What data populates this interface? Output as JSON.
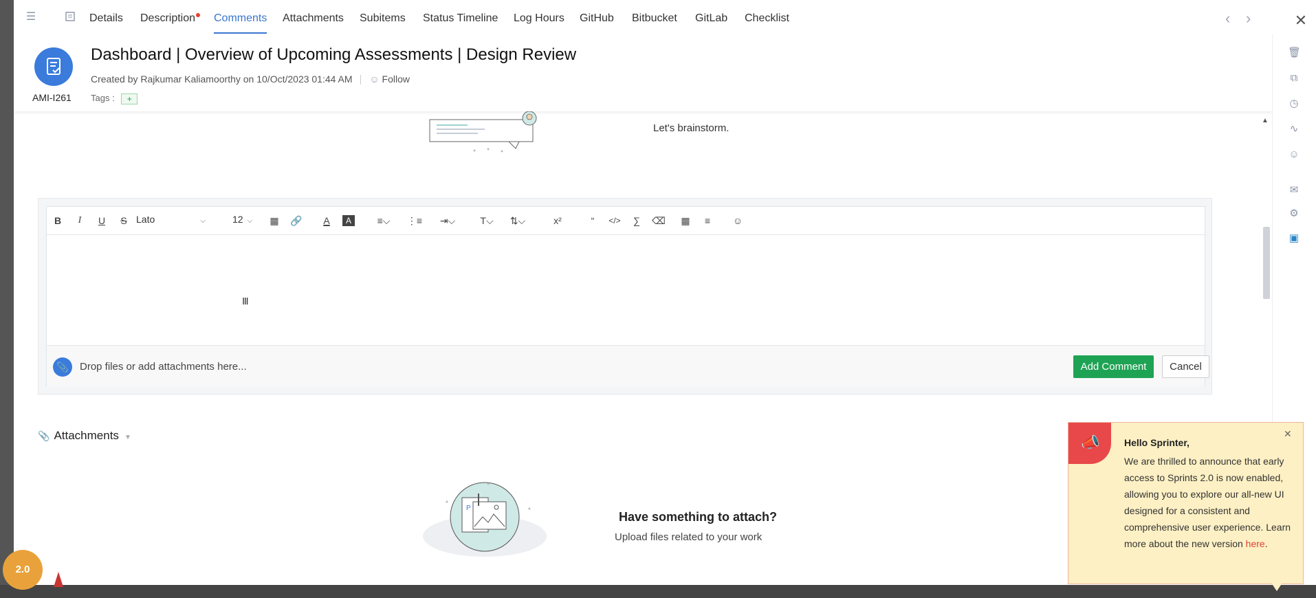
{
  "tabs": [
    {
      "label": "Details"
    },
    {
      "label": "Description"
    },
    {
      "label": "Comments"
    },
    {
      "label": "Attachments"
    },
    {
      "label": "Subitems"
    },
    {
      "label": "Status Timeline"
    },
    {
      "label": "Log Hours"
    },
    {
      "label": "GitHub"
    },
    {
      "label": "Bitbucket"
    },
    {
      "label": "GitLab"
    },
    {
      "label": "Checklist"
    }
  ],
  "active_tab": "Comments",
  "header": {
    "title": "Dashboard | Overview of Upcoming Assessments | Design Review",
    "created_by_prefix": "Created by",
    "creator": "Rajkumar Kaliamoorthy",
    "on_word": "on",
    "created_at": "10/Oct/2023 01:44 AM",
    "follow_label": "Follow",
    "item_id": "AMI-I261",
    "tags_label": "Tags :",
    "tag_add": "+"
  },
  "comments": {
    "empty_text": "Let's brainstorm."
  },
  "editor": {
    "font": "Lato",
    "font_size": "12",
    "drop_text": "Drop files or add attachments here...",
    "add_button": "Add Comment",
    "cancel_button": "Cancel"
  },
  "attachments": {
    "heading": "Attachments",
    "empty_title": "Have something to attach?",
    "empty_sub": "Upload files related to your work"
  },
  "toast": {
    "title": "Hello Sprinter,",
    "body": "We are thrilled to announce that early access to Sprints 2.0 is now enabled, allowing you to explore our all-new UI designed for a consistent and comprehensive user experience. Learn more about the new version",
    "link": "here",
    "period": "."
  },
  "badge": {
    "version": "2.0"
  },
  "colors": {
    "accent": "#3a76d0",
    "primary_button": "#1ea354",
    "toast_bg": "#fdf0c4",
    "toast_badge": "#e8484a"
  }
}
